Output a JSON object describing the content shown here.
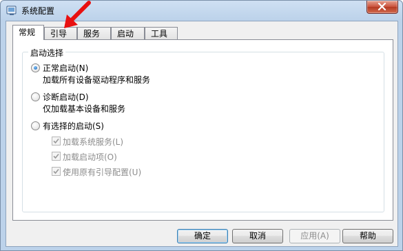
{
  "window": {
    "title": "系统配置"
  },
  "tabs": [
    {
      "label": "常规",
      "active": true
    },
    {
      "label": "引导",
      "active": false
    },
    {
      "label": "服务",
      "active": false
    },
    {
      "label": "启动",
      "active": false
    },
    {
      "label": "工具",
      "active": false
    }
  ],
  "startup_selection": {
    "group_label": "启动选择",
    "normal": {
      "label": "正常启动(N)",
      "desc": "加载所有设备驱动程序和服务",
      "checked": true
    },
    "diagnostic": {
      "label": "诊断启动(D)",
      "desc": "仅加载基本设备和服务",
      "checked": false
    },
    "selective": {
      "label": "有选择的启动(S)",
      "checked": false
    },
    "options": [
      {
        "label": "加载系统服务(L)",
        "checked": true
      },
      {
        "label": "加载启动项(O)",
        "checked": true
      },
      {
        "label": "使用原有引导配置(U)",
        "checked": true
      }
    ]
  },
  "buttons": {
    "ok": "确定",
    "cancel": "取消",
    "apply": "应用(A)",
    "help": "帮助"
  },
  "colors": {
    "accent": "#1d5fa8",
    "annotation_arrow": "#e81010"
  }
}
